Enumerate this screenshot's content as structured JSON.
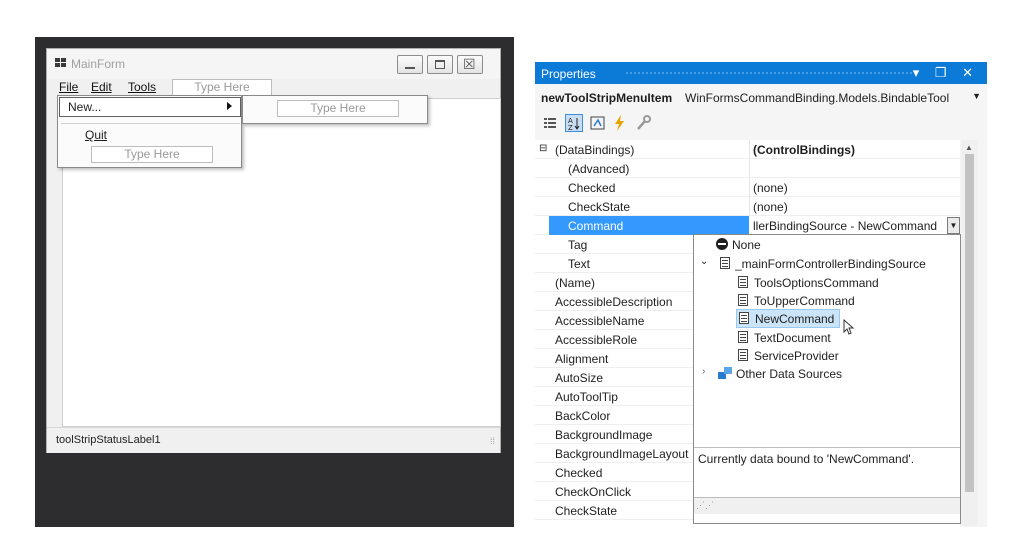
{
  "main_form": {
    "title": "MainForm",
    "menu": {
      "file": "File",
      "edit": "Edit",
      "tools": "Tools",
      "type_here": "Type Here"
    },
    "file_menu": {
      "new": "New...",
      "quit": "Quit",
      "type_here": "Type Here"
    },
    "submenu": {
      "type_here": "Type Here"
    },
    "status_label": "toolStripStatusLabel1"
  },
  "properties": {
    "title": "Properties",
    "title_buttons": "▾ ❐ ✕",
    "object_name": "newToolStripMenuItem",
    "object_type": "WinFormsCommandBinding.Models.BindableTool",
    "rows": [
      {
        "name": "(DataBindings)",
        "value": "(ControlBindings)"
      },
      {
        "name": "(Advanced)",
        "value": ""
      },
      {
        "name": "Checked",
        "value": "(none)"
      },
      {
        "name": "CheckState",
        "value": "(none)"
      },
      {
        "name": "Command",
        "value": "llerBindingSource - NewCommand"
      },
      {
        "name": "Tag",
        "value": ""
      },
      {
        "name": "Text",
        "value": ""
      },
      {
        "name": "(Name)",
        "value": ""
      },
      {
        "name": "AccessibleDescription",
        "value": ""
      },
      {
        "name": "AccessibleName",
        "value": ""
      },
      {
        "name": "AccessibleRole",
        "value": ""
      },
      {
        "name": "Alignment",
        "value": ""
      },
      {
        "name": "AutoSize",
        "value": ""
      },
      {
        "name": "AutoToolTip",
        "value": ""
      },
      {
        "name": "BackColor",
        "value": ""
      },
      {
        "name": "BackgroundImage",
        "value": ""
      },
      {
        "name": "BackgroundImageLayout",
        "value": ""
      },
      {
        "name": "Checked",
        "value": ""
      },
      {
        "name": "CheckOnClick",
        "value": ""
      },
      {
        "name": "CheckState",
        "value": ""
      }
    ],
    "command_dropdown": {
      "none": "None",
      "binding_source": "_mainFormControllerBindingSource",
      "items": [
        "ToolsOptionsCommand",
        "ToUpperCommand",
        "NewCommand",
        "TextDocument",
        "ServiceProvider"
      ],
      "other": "Other Data Sources",
      "description": "Currently data bound to 'NewCommand'."
    }
  },
  "colors": {
    "accent": "#0c7ad7",
    "selection": "#3399ff",
    "designer_bg": "#2d2d30"
  }
}
